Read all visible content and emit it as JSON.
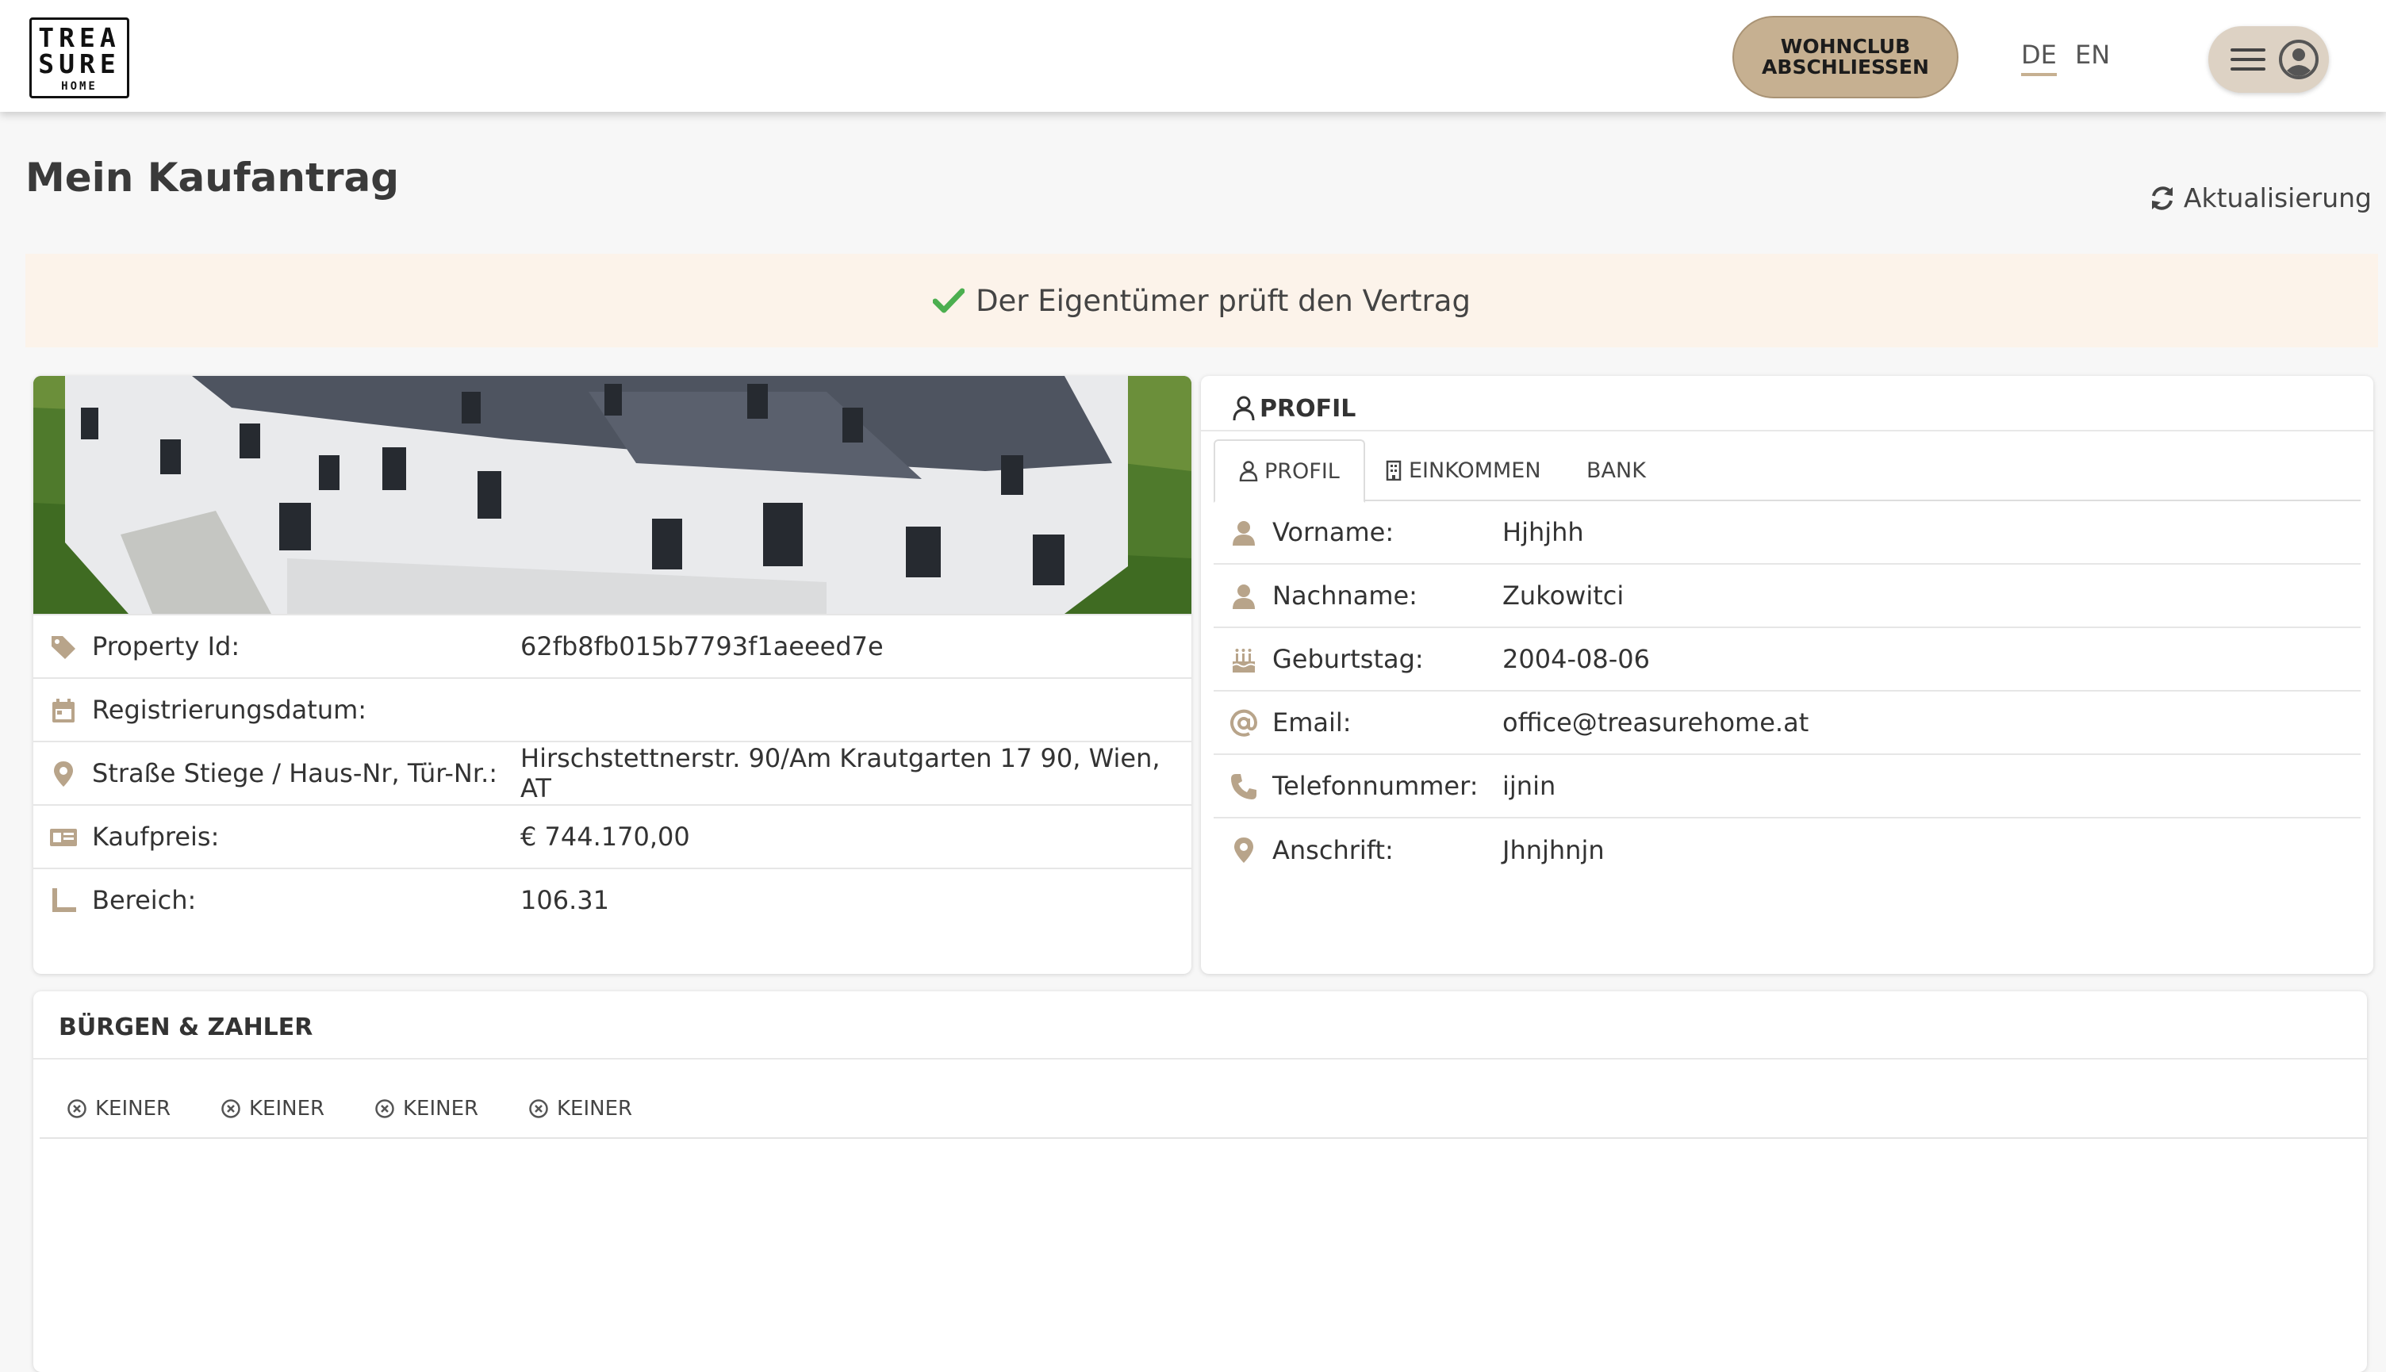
{
  "header": {
    "logo_line1": "TREA",
    "logo_line2": "SURE",
    "logo_line3": "HOME",
    "cta_label": "WOHNCLUB ABSCHLIESSEN",
    "lang_de": "DE",
    "lang_en": "EN",
    "active_lang": "DE"
  },
  "page": {
    "title": "Mein Kaufantrag",
    "refresh_label": "Aktualisierung"
  },
  "status": {
    "text": "Der Eigentümer prüft den Vertrag",
    "icon": "check-icon"
  },
  "property": {
    "rows": [
      {
        "icon": "tag-icon",
        "label": "Property Id:",
        "value": "62fb8fb015b7793f1aeeed7e"
      },
      {
        "icon": "calendar-icon",
        "label": "Registrierungsdatum:",
        "value": ""
      },
      {
        "icon": "location-pin-icon",
        "label": "Straße Stiege / Haus-Nr, Tür-Nr.:",
        "value": "Hirschstettnerstr. 90/Am Krautgarten 17 90, Wien, AT"
      },
      {
        "icon": "price-card-icon",
        "label": "Kaufpreis:",
        "value": "€ 744.170,00"
      },
      {
        "icon": "ruler-icon",
        "label": "Bereich:",
        "value": "106.31"
      }
    ]
  },
  "profile": {
    "title": "PROFIL",
    "tabs": [
      {
        "label": "PROFIL",
        "icon": "user-icon",
        "active": true
      },
      {
        "label": "EINKOMMEN",
        "icon": "building-icon",
        "active": false
      },
      {
        "label": "BANK",
        "icon": "",
        "active": false
      }
    ],
    "rows": [
      {
        "icon": "user-icon",
        "label": "Vorname:",
        "value": "Hjhjhh"
      },
      {
        "icon": "user-icon",
        "label": "Nachname:",
        "value": "Zukowitci"
      },
      {
        "icon": "birthday-cake-icon",
        "label": "Geburtstag:",
        "value": "2004-08-06"
      },
      {
        "icon": "at-icon",
        "label": "Email:",
        "value": "office@treasurehome.at"
      },
      {
        "icon": "phone-icon",
        "label": "Telefonnummer:",
        "value": "ijnin"
      },
      {
        "icon": "location-pin-icon",
        "label": "Anschrift:",
        "value": "Jhnjhnjn"
      }
    ]
  },
  "buergen": {
    "title": "BÜRGEN & ZAHLER",
    "tabs": [
      {
        "label": "KEINER",
        "icon": "circle-x-icon"
      },
      {
        "label": "KEINER",
        "icon": "circle-x-icon"
      },
      {
        "label": "KEINER",
        "icon": "circle-x-icon"
      },
      {
        "label": "KEINER",
        "icon": "circle-x-icon"
      }
    ]
  },
  "colors": {
    "accent": "#c6b091",
    "icon": "#b8a48a",
    "banner_bg": "#fcf3ea",
    "check": "#4caf50"
  }
}
